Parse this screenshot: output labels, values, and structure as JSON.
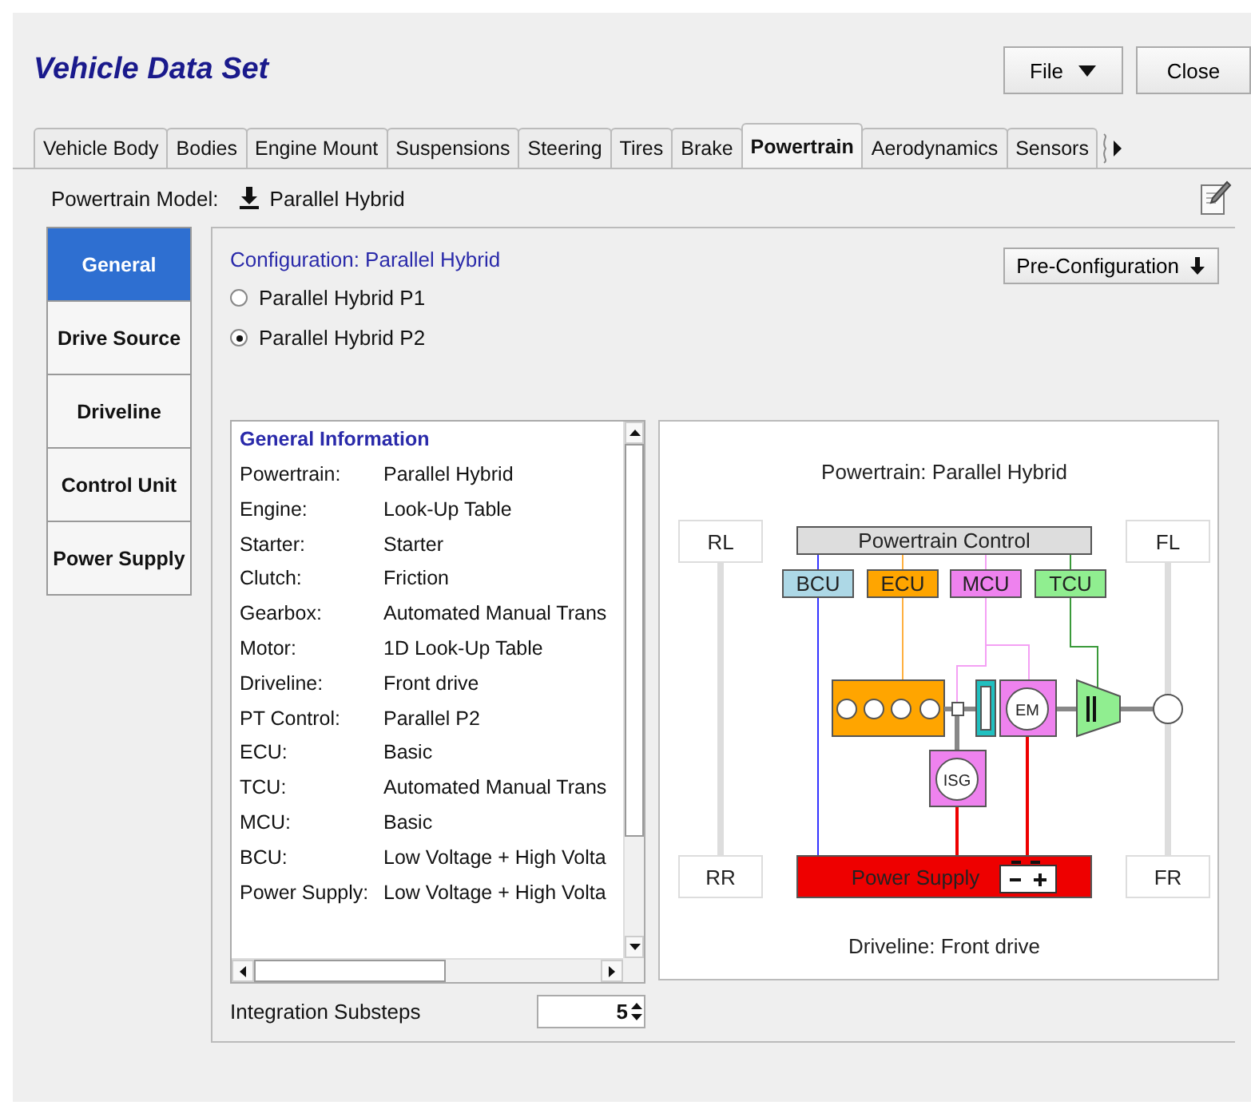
{
  "window": {
    "title": "Vehicle Data Set"
  },
  "header_buttons": [
    {
      "label": "File",
      "kind": "menu"
    },
    {
      "label": "Close",
      "kind": "plain"
    }
  ],
  "tabs": [
    {
      "label": "Vehicle Body",
      "selected": false
    },
    {
      "label": "Bodies",
      "selected": false
    },
    {
      "label": "Engine Mount",
      "selected": false
    },
    {
      "label": "Suspensions",
      "selected": false
    },
    {
      "label": "Steering",
      "selected": false
    },
    {
      "label": "Tires",
      "selected": false
    },
    {
      "label": "Brake",
      "selected": false
    },
    {
      "label": "Powertrain",
      "selected": true
    },
    {
      "label": "Aerodynamics",
      "selected": false
    },
    {
      "label": "Sensors",
      "selected": false
    }
  ],
  "model": {
    "label": "Powertrain Model:",
    "value": "Parallel Hybrid"
  },
  "side_tabs": [
    {
      "label": "General",
      "selected": true
    },
    {
      "label": "Drive Source",
      "selected": false
    },
    {
      "label": "Driveline",
      "selected": false
    },
    {
      "label": "Control Unit",
      "selected": false
    },
    {
      "label": "Power Supply",
      "selected": false
    }
  ],
  "configuration": {
    "title": "Configuration: Parallel Hybrid",
    "button": "Pre-Configuration",
    "options": [
      {
        "label": "Parallel Hybrid P1",
        "selected": false
      },
      {
        "label": "Parallel Hybrid P2",
        "selected": true
      }
    ]
  },
  "general_information": {
    "title": "General Information",
    "rows": [
      {
        "label": "Powertrain:",
        "value": "Parallel Hybrid"
      },
      {
        "label": "Engine:",
        "value": "Look-Up Table"
      },
      {
        "label": "Starter:",
        "value": "Starter"
      },
      {
        "label": "Clutch:",
        "value": "Friction"
      },
      {
        "label": "Gearbox:",
        "value": "Automated Manual Trans"
      },
      {
        "label": "Motor:",
        "value": "1D Look-Up Table"
      },
      {
        "label": "Driveline:",
        "value": "Front drive"
      },
      {
        "label": "PT Control:",
        "value": "Parallel P2"
      },
      {
        "label": "ECU:",
        "value": "Basic"
      },
      {
        "label": "TCU:",
        "value": "Automated Manual Trans"
      },
      {
        "label": "MCU:",
        "value": "Basic"
      },
      {
        "label": "BCU:",
        "value": "Low Voltage + High Volta"
      },
      {
        "label": "Power Supply:",
        "value": "Low Voltage + High Volta"
      }
    ]
  },
  "diagram": {
    "title": "Powertrain: Parallel Hybrid",
    "footer": "Driveline: Front drive",
    "wheels": [
      "RL",
      "FL",
      "RR",
      "FR"
    ],
    "control": "Powertrain Control",
    "controllers": [
      {
        "label": "BCU",
        "color": "#add8e6"
      },
      {
        "label": "ECU",
        "color": "#ffa500"
      },
      {
        "label": "MCU",
        "color": "#ee82ee"
      },
      {
        "label": "TCU",
        "color": "#90ee90"
      }
    ],
    "motor": "EM",
    "starter": "ISG",
    "power_supply": "Power Supply"
  },
  "integration_substeps": {
    "label": "Integration Substeps",
    "value": "5"
  }
}
